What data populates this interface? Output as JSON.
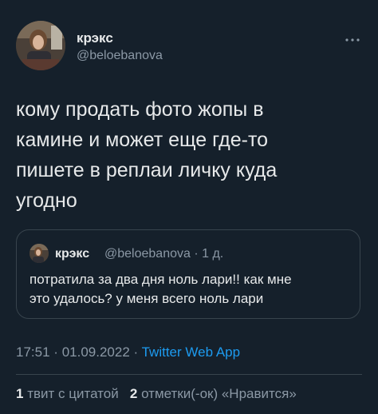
{
  "author": {
    "name": "крэкс",
    "handle": "@beloebanova"
  },
  "tweet": {
    "text": "кому продать фото жопы в\nкамине и может еще где-то\nпишете в реплаи личку куда\nугодно"
  },
  "quote": {
    "name": "крэкс",
    "handle": "@beloebanova",
    "separator": "·",
    "age": "1 д.",
    "text": "потратила за два дня ноль лари!! как мне\nэто удалось? у меня всего ноль лари"
  },
  "meta": {
    "time": "17:51",
    "separator": "·",
    "date": "01.09.2022",
    "source": "Twitter Web App"
  },
  "stats": {
    "quotes_count": "1",
    "quotes_label": "твит с цитатой",
    "likes_count": "2",
    "likes_label": "отметки(-ок) «Нравится»"
  },
  "icons": {
    "more": "more-dots-icon"
  },
  "colors": {
    "background": "#15202b",
    "text": "#e7e9ea",
    "secondary": "#8b98a5",
    "link": "#1d9bf0",
    "border": "#38444d"
  }
}
